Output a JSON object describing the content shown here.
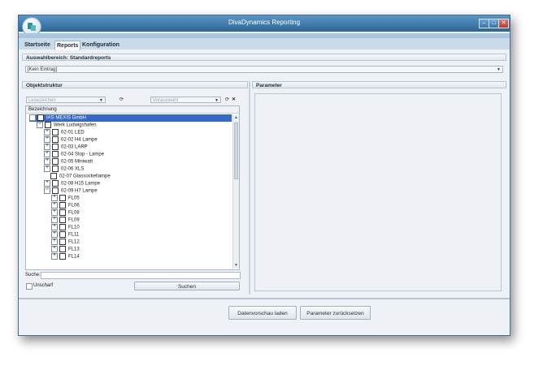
{
  "window": {
    "title": "DivaDynamics Reporting"
  },
  "tabs": [
    {
      "label": "Startseite"
    },
    {
      "label": "Reports"
    },
    {
      "label": "Konfiguration"
    }
  ],
  "selection_area": {
    "header": "Auswahlbereich: Standardreports",
    "combo_value": "[Kein Eintrag]"
  },
  "object_structure": {
    "header": "Objektstruktur",
    "bookmark_placeholder": "Lesezeichen",
    "preselect_placeholder": "Vorauswahl",
    "column_header": "Bezeichnung",
    "nodes": [
      {
        "label": "IAS MEXIS GmbH"
      },
      {
        "label": "Werk Ludwigshafen"
      },
      {
        "label": "02-01 LED"
      },
      {
        "label": "02-02 H4 Lampe"
      },
      {
        "label": "02-03 LARP"
      },
      {
        "label": "02-04 Stop - Lampe"
      },
      {
        "label": "02-05 Miniwatt"
      },
      {
        "label": "02-06 XLS"
      },
      {
        "label": "02-07 Glassockellampe"
      },
      {
        "label": "02-08 H15 Lampe"
      },
      {
        "label": "02-09 H7 Lampe"
      },
      {
        "label": "FL05"
      },
      {
        "label": "FL06"
      },
      {
        "label": "FL08"
      },
      {
        "label": "FL09"
      },
      {
        "label": "FL10"
      },
      {
        "label": "FL11"
      },
      {
        "label": "FL12"
      },
      {
        "label": "FL13"
      },
      {
        "label": "FL14"
      }
    ],
    "search_label": "Suche:",
    "fuzzy_label": "Unscharf",
    "search_button": "Suchen"
  },
  "parameters": {
    "header": "Parameter"
  },
  "footer": {
    "preview_button": "Datenvorschau laden",
    "reset_button": "Parameter zurücksetzen"
  },
  "colors": {
    "title_bar": "#2c6597",
    "selection": "#3669c9",
    "tab_strip": "#a9c6de"
  },
  "icons": [
    "app-logo-icon",
    "minimize-icon",
    "maximize-icon",
    "close-icon",
    "chevron-down-icon",
    "refresh-icon",
    "clear-icon",
    "expand-icon",
    "collapse-icon"
  ]
}
